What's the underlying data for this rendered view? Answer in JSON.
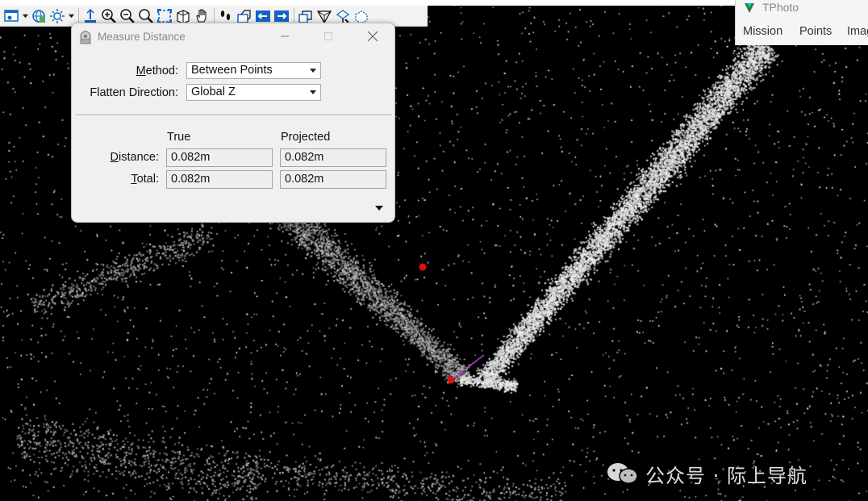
{
  "dialog": {
    "title": "Measure Distance",
    "method_label": "Method:",
    "method_value": "Between Points",
    "flatten_label": "Flatten Direction:",
    "flatten_value": "Global Z",
    "col_true": "True",
    "col_projected": "Projected",
    "distance_label": "Distance:",
    "total_label": "Total:",
    "distance_true": "0.082m",
    "distance_projected": "0.082m",
    "total_true": "0.082m",
    "total_projected": "0.082m"
  },
  "tphoto": {
    "title": "TPhoto",
    "menu": [
      "Mission",
      "Points",
      "Imag"
    ]
  },
  "watermark": {
    "text": "公众号 · 际上导航"
  },
  "colors": {
    "background": "#000000",
    "points": "#ffffff",
    "measure_point": "#e01010",
    "measure_line": "#b040d0",
    "toolbar_blue": "#1565c0"
  },
  "icons": [
    "view-icon",
    "dropdown-icon",
    "globe-icon",
    "light-icon",
    "dropdown-icon",
    "fit-icon",
    "zoom-in-icon",
    "zoom-out-icon",
    "zoom-window-icon",
    "fit-view-icon",
    "rotate-view-icon",
    "pan-icon",
    "walk-icon",
    "camera-icon",
    "previous-view-icon",
    "next-view-icon",
    "copy-view-icon",
    "view-cube-icon",
    "display-style-icon",
    "clip-icon"
  ]
}
